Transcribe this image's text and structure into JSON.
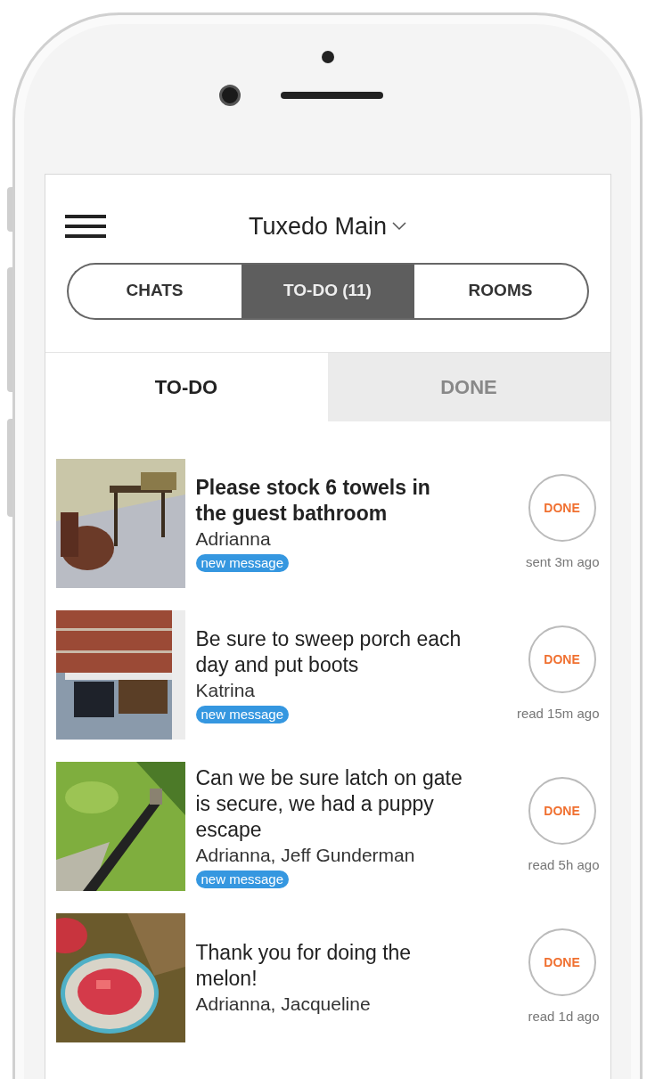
{
  "header": {
    "title": "Tuxedo Main"
  },
  "segments": [
    {
      "label": "CHATS",
      "selected": false
    },
    {
      "label": "TO-DO (11)",
      "selected": true
    },
    {
      "label": "ROOMS",
      "selected": false
    }
  ],
  "subtabs": [
    {
      "label": "TO-DO",
      "selected": true
    },
    {
      "label": "DONE",
      "selected": false
    }
  ],
  "tasks": [
    {
      "title": "Please stock 6 towels in the guest bathroom",
      "people": "Adrianna",
      "badge": "new message",
      "unread": true,
      "button": "DONE",
      "time": "sent 3m ago"
    },
    {
      "title": "Be sure to sweep porch each day and put boots",
      "people": "Katrina",
      "badge": "new message",
      "unread": false,
      "button": "DONE",
      "time": "read 15m ago"
    },
    {
      "title": "Can we be sure latch on gate is secure, we had a puppy escape",
      "people": "Adrianna, Jeff Gunderman",
      "badge": "new message",
      "unread": false,
      "button": "DONE",
      "time": "read 5h ago"
    },
    {
      "title": "Thank you for doing the melon!",
      "people": "Adrianna, Jacqueline",
      "unread": false,
      "button": "DONE",
      "time": "read 1d ago"
    }
  ]
}
